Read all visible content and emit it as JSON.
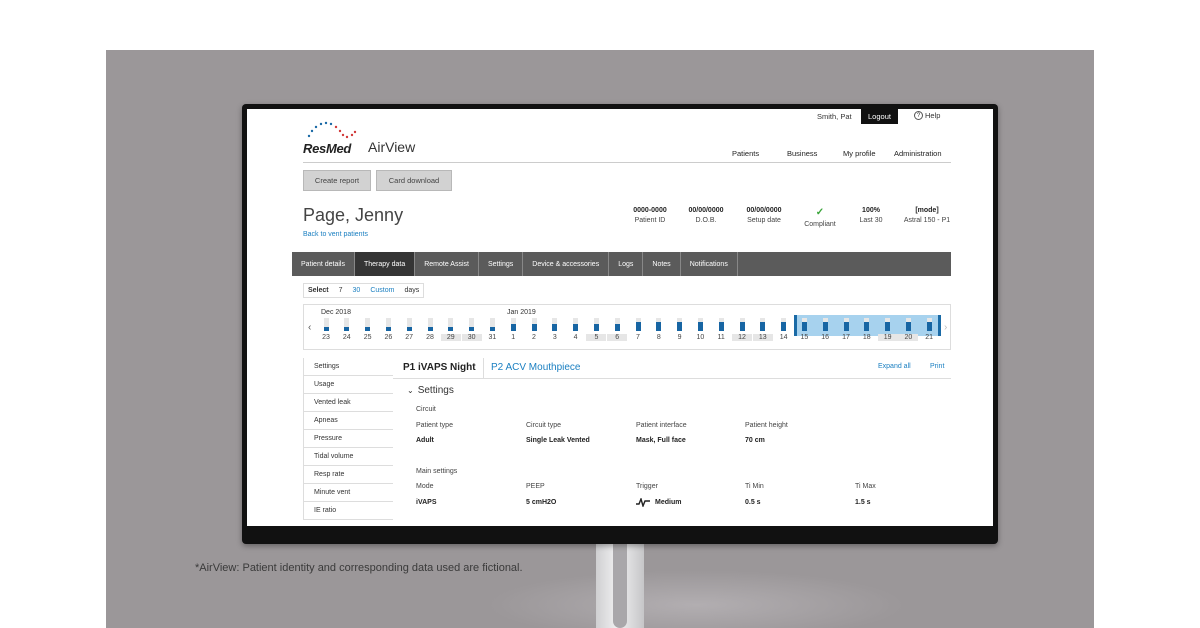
{
  "header": {
    "brand": "ResMed",
    "product": "AirView",
    "user_name": "Smith, Pat",
    "logout_label": "Logout",
    "help_label": "Help",
    "nav": [
      "Patients",
      "Business",
      "My profile",
      "Administration"
    ]
  },
  "toolbar": {
    "create_report": "Create report",
    "card_download": "Card download"
  },
  "patient": {
    "name": "Page, Jenny",
    "back_link": "Back to vent patients",
    "stats": [
      {
        "value": "0000-0000",
        "label": "Patient ID"
      },
      {
        "value": "00/00/0000",
        "label": "D.O.B."
      },
      {
        "value": "00/00/0000",
        "label": "Setup date"
      },
      {
        "value": "✓",
        "label": "Compliant"
      },
      {
        "value": "100%",
        "label": "Last 30"
      },
      {
        "value": "[mode]",
        "label": "Astral 150 - P1"
      }
    ]
  },
  "tabs": [
    "Patient details",
    "Therapy data",
    "Remote Assist",
    "Settings",
    "Device & accessories",
    "Logs",
    "Notes",
    "Notifications"
  ],
  "select": {
    "label": "Select",
    "opt1": "7",
    "opt2": "30",
    "opt3": "Custom",
    "unit": "days"
  },
  "calendar": {
    "month1": "Dec 2018",
    "month2": "Jan 2019",
    "days": [
      "23",
      "24",
      "25",
      "26",
      "27",
      "28",
      "29",
      "30",
      "31",
      "1",
      "2",
      "3",
      "4",
      "5",
      "6",
      "7",
      "8",
      "9",
      "10",
      "11",
      "12",
      "13",
      "14",
      "15",
      "16",
      "17",
      "18",
      "19",
      "20",
      "21"
    ],
    "usage": [
      0.3,
      0.3,
      0.3,
      0.3,
      0.3,
      0.3,
      0.3,
      0.3,
      0.3,
      0.5,
      0.5,
      0.5,
      0.5,
      0.5,
      0.5,
      0.7,
      0.7,
      0.7,
      0.7,
      0.7,
      0.7,
      0.7,
      0.7,
      0.7,
      0.7,
      0.7,
      0.7,
      0.7,
      0.7,
      0.7
    ]
  },
  "sidebar": [
    "Settings",
    "Usage",
    "Vented leak",
    "Apneas",
    "Pressure",
    "Tidal volume",
    "Resp rate",
    "Minute vent",
    "IE ratio"
  ],
  "programs": {
    "p1": "P1 iVAPS Night",
    "p2": "P2 ACV Mouthpiece",
    "expand_all": "Expand all",
    "print": "Print"
  },
  "settings": {
    "title": "Settings",
    "circuit_heading": "Circuit",
    "circuit": [
      {
        "label": "Patient type",
        "value": "Adult"
      },
      {
        "label": "Circuit type",
        "value": "Single Leak Vented"
      },
      {
        "label": "Patient interface",
        "value": "Mask, Full face"
      },
      {
        "label": "Patient height",
        "value": "70 cm"
      }
    ],
    "main_heading": "Main settings",
    "main": [
      {
        "label": "Mode",
        "value": "iVAPS"
      },
      {
        "label": "PEEP",
        "value": "5 cmH2O"
      },
      {
        "label": "Trigger",
        "value": "Medium"
      },
      {
        "label": "Ti Min",
        "value": "0.5 s"
      },
      {
        "label": "Ti Max",
        "value": "1.5 s"
      }
    ]
  },
  "caption": "*AirView: Patient identity and corresponding data used are fictional."
}
